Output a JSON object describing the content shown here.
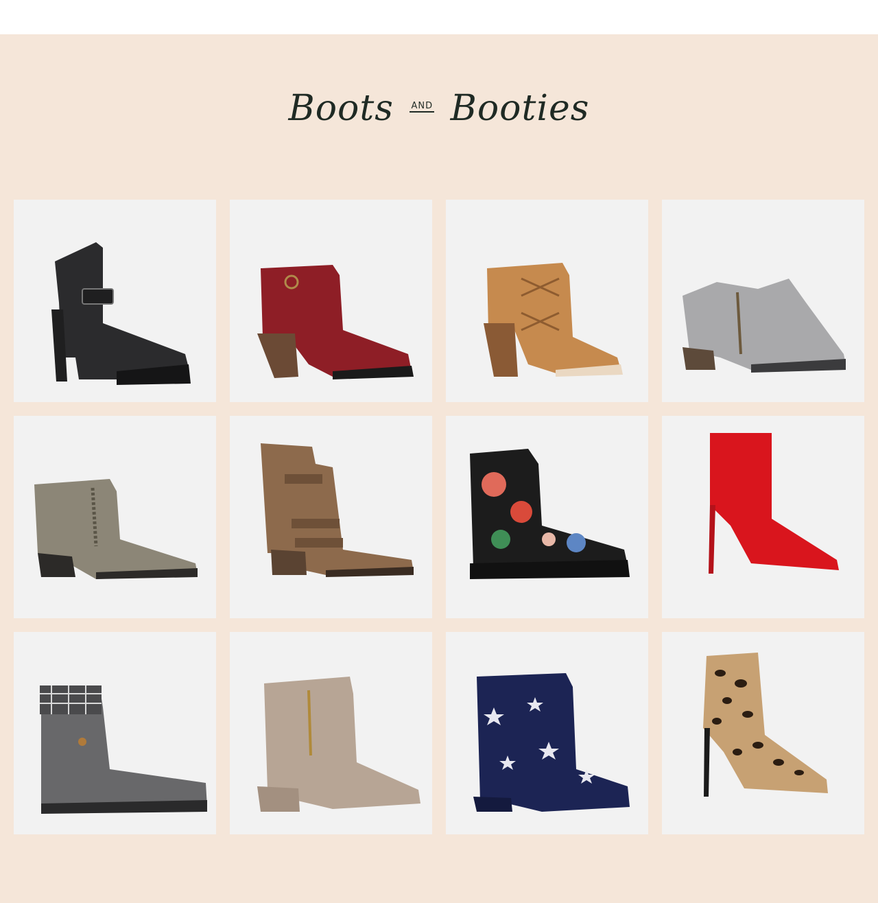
{
  "section": {
    "title_word1": "Boots",
    "title_and": "AND",
    "title_word2": "Booties"
  },
  "products": [
    {
      "name": "black-lace-up-platform-bootie-buckle",
      "color": "#2b2b2d"
    },
    {
      "name": "burgundy-buckle-strap-block-heel-bootie",
      "color": "#8e1e26"
    },
    {
      "name": "tan-woven-block-heel-bootie",
      "color": "#c68a4e"
    },
    {
      "name": "gray-perforated-side-zip-bootie",
      "color": "#a9a9ab"
    },
    {
      "name": "metallic-pewter-whipstitch-bootie",
      "color": "#8c8677"
    },
    {
      "name": "brown-triple-buckle-moto-boot",
      "color": "#8d6a4c"
    },
    {
      "name": "floral-print-lace-up-combat-boot",
      "color": "#1c1c1c"
    },
    {
      "name": "red-pointed-toe-stiletto-bootie",
      "color": "#d9151d"
    },
    {
      "name": "gray-plaid-cuff-lace-up-boot",
      "color": "#68686a"
    },
    {
      "name": "taupe-side-zip-block-heel-bootie",
      "color": "#b7a595"
    },
    {
      "name": "navy-velvet-star-bootie",
      "color": "#1c2454"
    },
    {
      "name": "leopard-print-stiletto-bootie",
      "color": "#c7a173"
    }
  ]
}
